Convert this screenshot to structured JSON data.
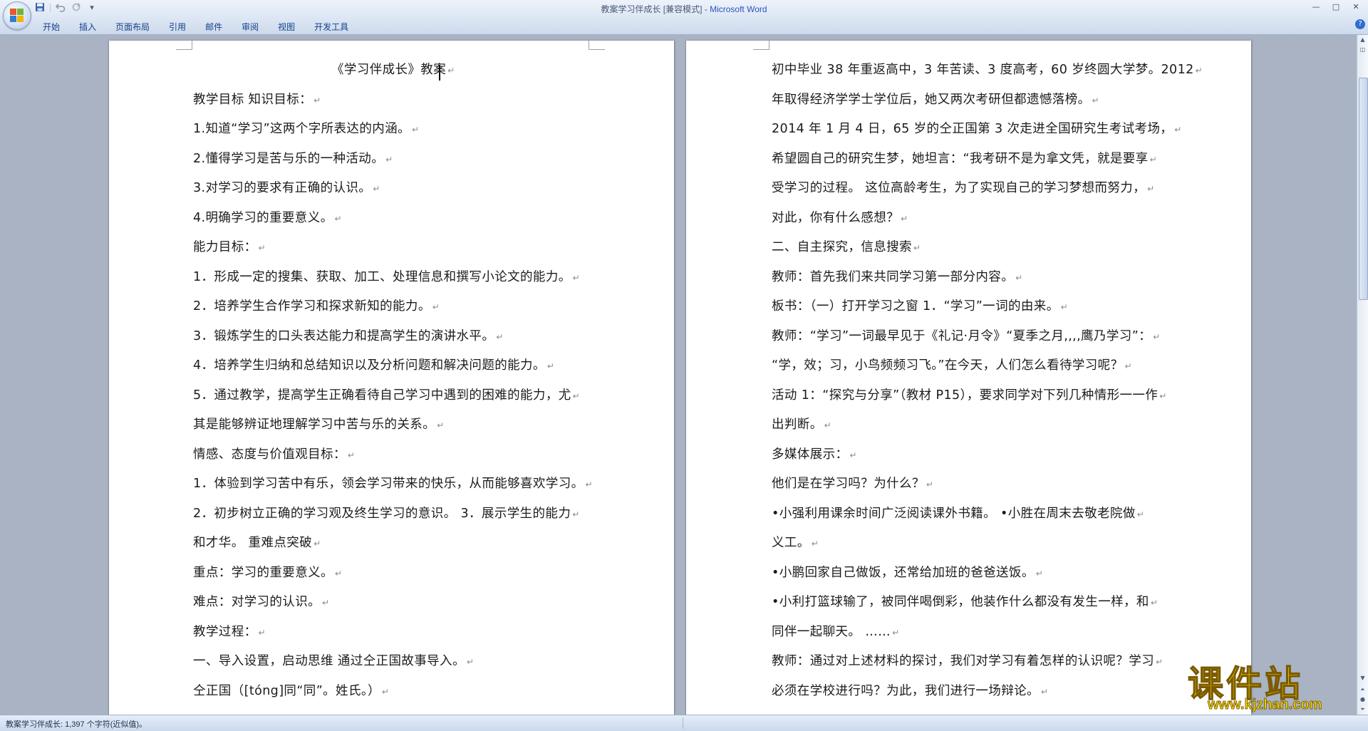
{
  "window": {
    "title_prefix": "教案学习伴成长 [兼容模式] - ",
    "title_app": "Microsoft Word",
    "minimize": "—",
    "maximize": "□",
    "close": "✕"
  },
  "qat": {
    "save_icon": "save-icon",
    "undo_icon": "undo-icon",
    "redo_icon": "redo-icon",
    "customize_icon": "dropdown-icon"
  },
  "ribbon": {
    "tabs": [
      "开始",
      "插入",
      "页面布局",
      "引用",
      "邮件",
      "审阅",
      "视图",
      "开发工具"
    ],
    "help": "?"
  },
  "document": {
    "left_page": [
      "《学习伴成长》教案",
      "教学目标 知识目标：",
      " 1.知道“学习”这两个字所表达的内涵。",
      " 2.懂得学习是苦与乐的一种活动。",
      " 3.对学习的要求有正确的认识。",
      " 4.明确学习的重要意义。",
      " 能力目标：",
      "1．形成一定的搜集、获取、加工、处理信息和撰写小论文的能力。",
      "2．培养学生合作学习和探求新知的能力。",
      "3．锻炼学生的口头表达能力和提高学生的演讲水平。",
      "4．培养学生归纳和总结知识以及分析问题和解决问题的能力。",
      "5．通过教学，提高学生正确看待自己学习中遇到的困难的能力，尤",
      "其是能够辨证地理解学习中苦与乐的关系。",
      " 情感、态度与价值观目标：",
      "1．体验到学习苦中有乐，领会学习带来的快乐，从而能够喜欢学习。",
      "2．初步树立正确的学习观及终生学习的意识。 3．展示学生的能力",
      "和才华。 重难点突破",
      "重点：学习的重要意义。",
      "难点：对学习的认识。",
      "教学过程：",
      "一、导入设置，启动思维 通过仝正国故事导入。",
      "仝正国（[tóng]同“同”。姓氏。）"
    ],
    "right_page": [
      "初中毕业 38 年重返高中，3 年苦读、3 度高考，60 岁终圆大学梦。2012",
      "年取得经济学学士学位后，她又两次考研但都遗憾落榜。",
      "2014 年 1 月 4 日，65 岁的仝正国第 3 次走进全国研究生考试考场，",
      "希望圆自己的研究生梦，她坦言：“我考研不是为拿文凭，就是要享",
      "受学习的过程。 这位高龄考生，为了实现自己的学习梦想而努力，",
      "对此，你有什么感想？",
      " 二、自主探究，信息搜索",
      "教师：首先我们来共同学习第一部分内容。",
      "板书：（一）打开学习之窗 1．“学习”一词的由来。",
      "教师：“学习”一词最早见于《礼记·月令》“夏季之月,,,,鹰乃学习”：",
      "“学，效；习，小鸟频频习飞。”在今天，人们怎么看待学习呢？",
      "活动 1：“探究与分享”（教材 P15），要求同学对下列几种情形一一作",
      "出判断。",
      " 多媒体展示：",
      "他们是在学习吗？为什么？",
      "•小强利用课余时间广泛阅读课外书籍。 •小胜在周末去敬老院做",
      "义工。",
      "•小鹏回家自己做饭，还常给加班的爸爸送饭。",
      "•小利打篮球输了，被同伴喝倒彩，他装作什么都没有发生一样，和",
      "同伴一起聊天。 ……",
      "教师：通过对上述材料的探讨，我们对学习有着怎样的认识呢？学习",
      "必须在学校进行吗？为此，我们进行一场辩论。"
    ],
    "paragraph_mark": "↵"
  },
  "statusbar": {
    "text": "教案学习伴成长: 1,397 个字符(近似值)。"
  },
  "watermark": {
    "cn": "课件站",
    "url": "www.kjzhan.com"
  },
  "colors": {
    "workspace": "#a9b3c4",
    "ribbon_text": "#15428b",
    "title_app": "#2a54b8",
    "watermark_fill": "#f2d400"
  }
}
